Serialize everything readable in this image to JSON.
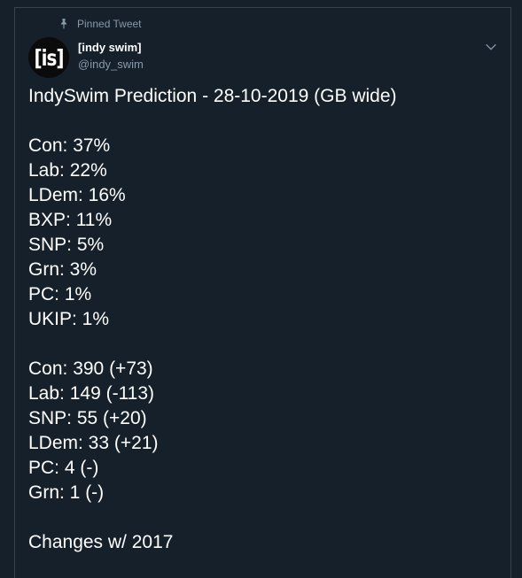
{
  "tweet": {
    "pinned_label": "Pinned Tweet",
    "author": {
      "avatar_text": "[is]",
      "name": "[indy swim]",
      "handle": "@indy_swim"
    },
    "title": "IndySwim Prediction - 28-10-2019 (GB wide)",
    "vote_shares": [
      "Con: 37%",
      "Lab: 22%",
      "LDem: 16%",
      "BXP: 11%",
      "SNP: 5%",
      "Grn: 3%",
      "PC: 1%",
      "UKIP: 1%"
    ],
    "seats": [
      "Con: 390 (+73)",
      "Lab: 149 (-113)",
      "SNP: 55 (+20)",
      "LDem: 33 (+21)",
      "PC: 4 (-)",
      "Grn: 1 (-)"
    ],
    "footer_note": "Changes w/ 2017"
  },
  "icons": {
    "pin": "pin-icon",
    "caret": "chevron-down-icon"
  },
  "colors": {
    "background": "#15202b",
    "border": "#38444d",
    "secondary_text": "#8899a6",
    "primary_text": "#ffffff"
  }
}
